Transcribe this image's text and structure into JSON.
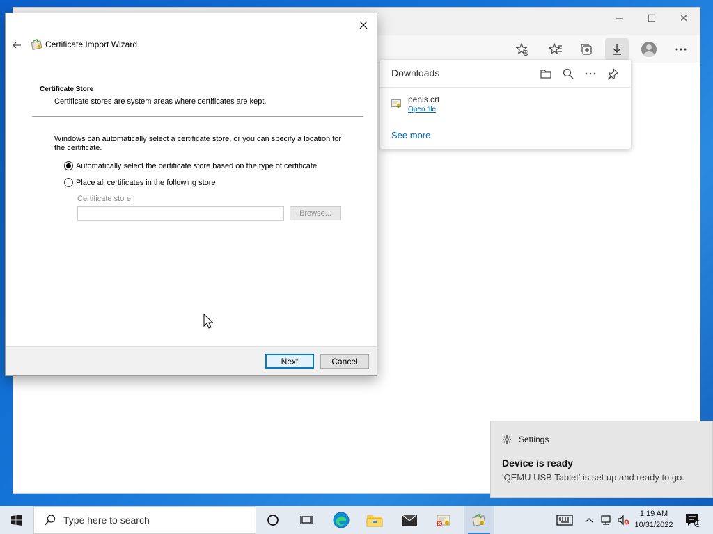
{
  "browser": {
    "window_controls": {
      "minimize": "─",
      "maximize": "☐",
      "close": "✕"
    }
  },
  "downloads": {
    "title": "Downloads",
    "item": {
      "filename": "penis.crt",
      "action": "Open file"
    },
    "see_more": "See more"
  },
  "dialog": {
    "title": "Certificate Import Wizard",
    "section_title": "Certificate Store",
    "section_desc": "Certificate stores are system areas where certificates are kept.",
    "intro": "Windows can automatically select a certificate store, or you can specify a location for the certificate.",
    "options": [
      {
        "label": "Automatically select the certificate store based on the type of certificate",
        "checked": true
      },
      {
        "label": "Place all certificates in the following store",
        "checked": false
      }
    ],
    "store_label": "Certificate store:",
    "store_value": "",
    "browse_label": "Browse...",
    "next_label": "Next",
    "cancel_label": "Cancel"
  },
  "toast": {
    "app": "Settings",
    "title": "Device is ready",
    "body": "'QEMU USB Tablet' is set up and ready to go."
  },
  "taskbar": {
    "search_placeholder": "Type here to search",
    "time": "1:19 AM",
    "date": "10/31/2022",
    "notification_count": "1"
  },
  "colors": {
    "accent": "#0078d7",
    "link": "#0066b4",
    "taskbar": "#e3eaf2"
  }
}
